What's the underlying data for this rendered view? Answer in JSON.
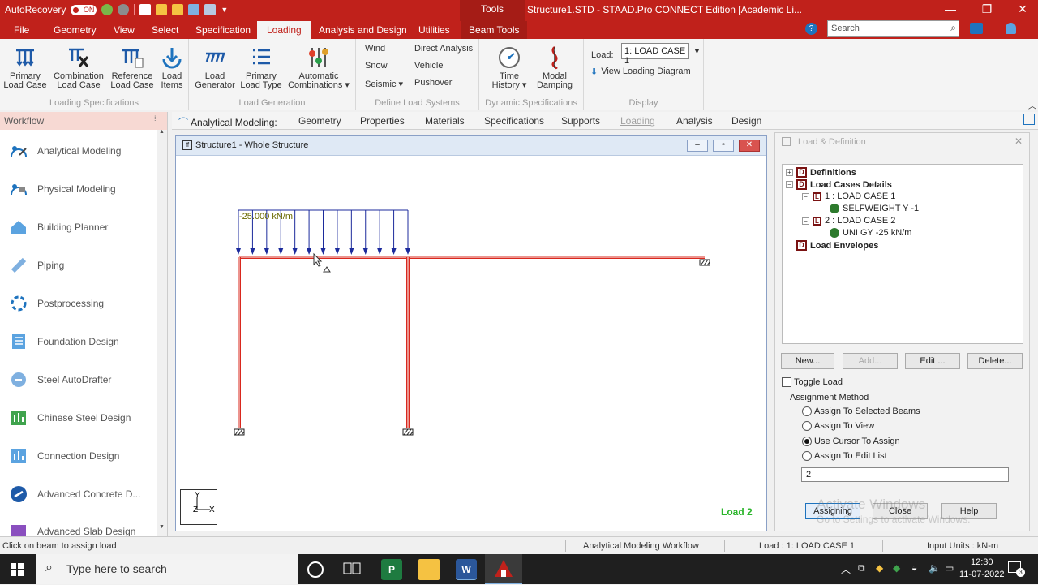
{
  "titlebar": {
    "autorecovery": "AutoRecovery",
    "autorecovery_state": "ON",
    "tools_tab": "Tools",
    "title": "Structure1.STD - STAAD.Pro CONNECT Edition [Academic Li..."
  },
  "menu": {
    "items": [
      "File",
      "Geometry",
      "View",
      "Select",
      "Specification",
      "Loading",
      "Analysis and Design",
      "Utilities",
      "Beam Tools"
    ],
    "search_placeholder": "Search"
  },
  "ribbon": {
    "loading_specs": {
      "label": "Loading Specifications",
      "primary": [
        "Primary",
        "Load Case"
      ],
      "combination": [
        "Combination",
        "Load Case"
      ],
      "reference": [
        "Reference",
        "Load Case"
      ],
      "items": [
        "Load",
        "Items"
      ]
    },
    "load_generation": {
      "label": "Load Generation",
      "generator": [
        "Load",
        "Generator"
      ],
      "primary_type": [
        "Primary",
        "Load Type"
      ],
      "auto": [
        "Automatic",
        "Combinations ▾"
      ]
    },
    "define_systems": {
      "label": "Define Load Systems",
      "wind": "Wind",
      "snow": "Snow",
      "seismic": "Seismic ▾",
      "direct": "Direct Analysis",
      "vehicle": "Vehicle",
      "pushover": "Pushover"
    },
    "dynamic": {
      "label": "Dynamic Specifications",
      "time": [
        "Time",
        "History ▾"
      ],
      "modal": [
        "Modal",
        "Damping"
      ]
    },
    "display": {
      "label": "Display",
      "load_label": "Load:",
      "load_value": "1: LOAD CASE 1",
      "view_diagram": "View Loading Diagram"
    }
  },
  "workflow": {
    "header": "Workflow",
    "items": [
      "Analytical Modeling",
      "Physical Modeling",
      "Building Planner",
      "Piping",
      "Postprocessing",
      "Foundation Design",
      "Steel AutoDrafter",
      "Chinese Steel Design",
      "Connection Design",
      "Advanced Concrete D...",
      "Advanced Slab Design"
    ]
  },
  "modeling_tabs": {
    "title": "Analytical Modeling:",
    "items": [
      "Geometry",
      "Properties",
      "Materials",
      "Specifications",
      "Supports",
      "Loading",
      "Analysis",
      "Design"
    ]
  },
  "view_window": {
    "title": "Structure1 - Whole Structure",
    "load_text": "-25.000 kN/m",
    "load_label": "Load 2",
    "axis_y": "Y",
    "axis_z": "Z",
    "axis_x": "X"
  },
  "load_panel": {
    "title": "Load & Definition",
    "tree": {
      "definitions": "Definitions",
      "details": "Load Cases Details",
      "case1": "1 : LOAD CASE 1",
      "case1_item": "SELFWEIGHT Y -1",
      "case2": "2 : LOAD CASE 2",
      "case2_item": "UNI GY -25 kN/m",
      "envelopes": "Load Envelopes"
    },
    "buttons": {
      "new": "New...",
      "add": "Add...",
      "edit": "Edit ...",
      "delete": "Delete..."
    },
    "toggle_load": "Toggle Load",
    "assignment_method": "Assignment Method",
    "options": [
      "Assign To Selected Beams",
      "Assign To View",
      "Use Cursor To Assign",
      "Assign To Edit List"
    ],
    "edit_list_value": "2",
    "bottom_buttons": {
      "assigning": "Assigning",
      "close": "Close",
      "help": "Help"
    },
    "watermark_title": "Activate Windows",
    "watermark_sub": "Go to Settings to activate Windows."
  },
  "status": {
    "hint": "Click on beam to assign load",
    "workflow": "Analytical Modeling Workflow",
    "load": "Load : 1: LOAD CASE 1",
    "units": "Input Units : kN-m"
  },
  "taskbar": {
    "search_placeholder": "Type here to search",
    "time": "12:30",
    "date": "11-07-2022",
    "notif_count": "3"
  },
  "colors": {
    "brand": "#c0211b",
    "beam": "#d9281e",
    "load_arrow": "#1c2b9c",
    "load_text": "#6b6b00",
    "load_label": "#2bb52b"
  }
}
